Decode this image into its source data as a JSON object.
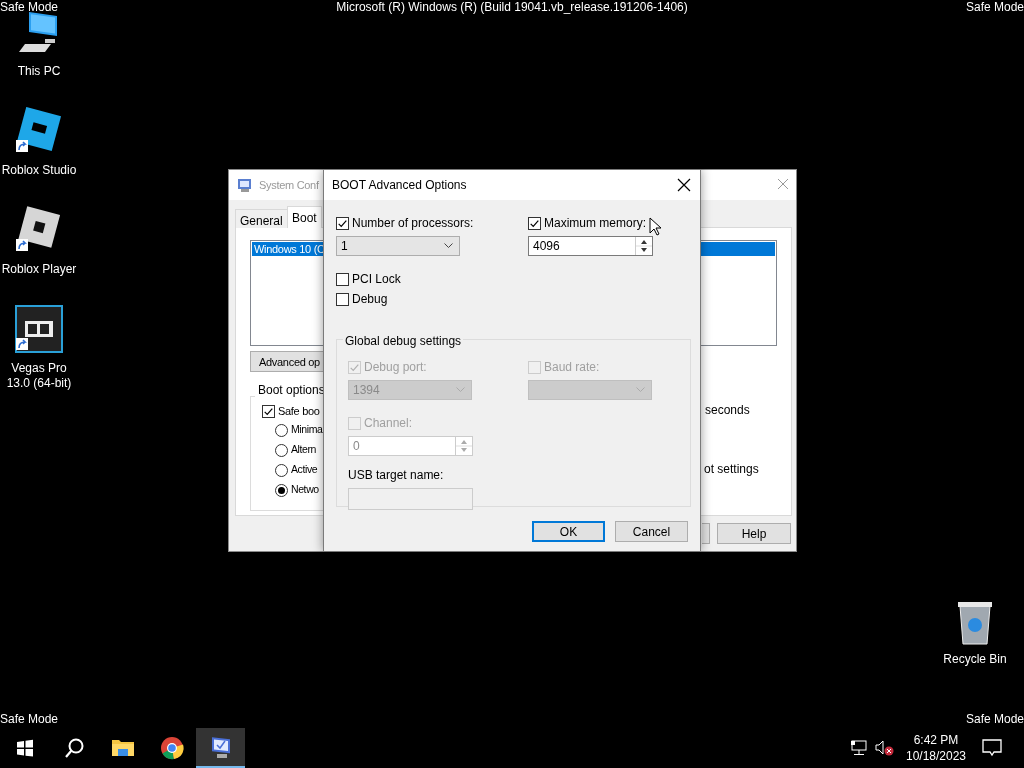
{
  "desktop": {
    "watermarks": [
      "Safe Mode",
      "Safe Mode",
      "Safe Mode",
      "Safe Mode"
    ],
    "build_text": "Microsoft (R) Windows (R) (Build 19041.vb_release.191206-1406)",
    "icons": [
      {
        "kind": "computer",
        "label": "This PC",
        "shortcut": false
      },
      {
        "kind": "studio",
        "label": "Roblox Studio",
        "shortcut": true
      },
      {
        "kind": "player",
        "label": "Roblox Player",
        "shortcut": true
      },
      {
        "kind": "video",
        "label": "Vegas Pro 13.0 (64-bit)",
        "shortcut": true
      }
    ],
    "recycle_bin": {
      "label": "Recycle Bin"
    }
  },
  "background_window": {
    "title": "System Conf",
    "tabs": [
      {
        "label": "General",
        "selected": false
      },
      {
        "label": "Boot",
        "selected": true
      }
    ],
    "os_list": [
      {
        "label": "Windows 10 (C",
        "selected": true
      }
    ],
    "advanced_button": "Advanced op",
    "boot_options": {
      "title": "Boot options",
      "safe_boot": {
        "label": "Safe boo",
        "checked": true
      },
      "modes": [
        {
          "label": "Minima",
          "selected": false
        },
        {
          "label": "Altern",
          "selected": false
        },
        {
          "label": "Active",
          "selected": false
        },
        {
          "label": "Netwo",
          "selected": true
        }
      ]
    },
    "timeout_unit": "seconds",
    "permanent_text": "ot settings",
    "help_button": "Help"
  },
  "dialog": {
    "title": "BOOT Advanced Options",
    "processors": {
      "label": "Number of processors:",
      "checked": true,
      "value": "1"
    },
    "max_memory": {
      "label": "Maximum memory:",
      "checked": true,
      "value": "4096"
    },
    "pci_lock": {
      "label": "PCI Lock",
      "checked": false
    },
    "debug": {
      "label": "Debug",
      "checked": false
    },
    "debug_settings": {
      "title": "Global debug settings",
      "debug_port": {
        "label": "Debug port:",
        "checked": true,
        "disabled": true,
        "value": "1394"
      },
      "baud_rate": {
        "label": "Baud rate:",
        "checked": false,
        "disabled": true
      },
      "channel": {
        "label": "Channel:",
        "checked": false,
        "disabled": true,
        "value": "0"
      },
      "usb_target": {
        "label": "USB target name:",
        "disabled": true
      }
    },
    "buttons": [
      {
        "label": "OK",
        "default": true
      },
      {
        "label": "Cancel",
        "default": false
      }
    ]
  },
  "taskbar": {
    "apps": [
      {
        "kind": "start",
        "active": false
      },
      {
        "kind": "search",
        "active": false
      },
      {
        "kind": "folder",
        "active": false
      },
      {
        "kind": "browser",
        "active": false
      },
      {
        "kind": "sysconfig",
        "active": true
      }
    ],
    "tray": {
      "volume_muted": true,
      "time": "6:42 PM",
      "date": "10/18/2023"
    }
  }
}
